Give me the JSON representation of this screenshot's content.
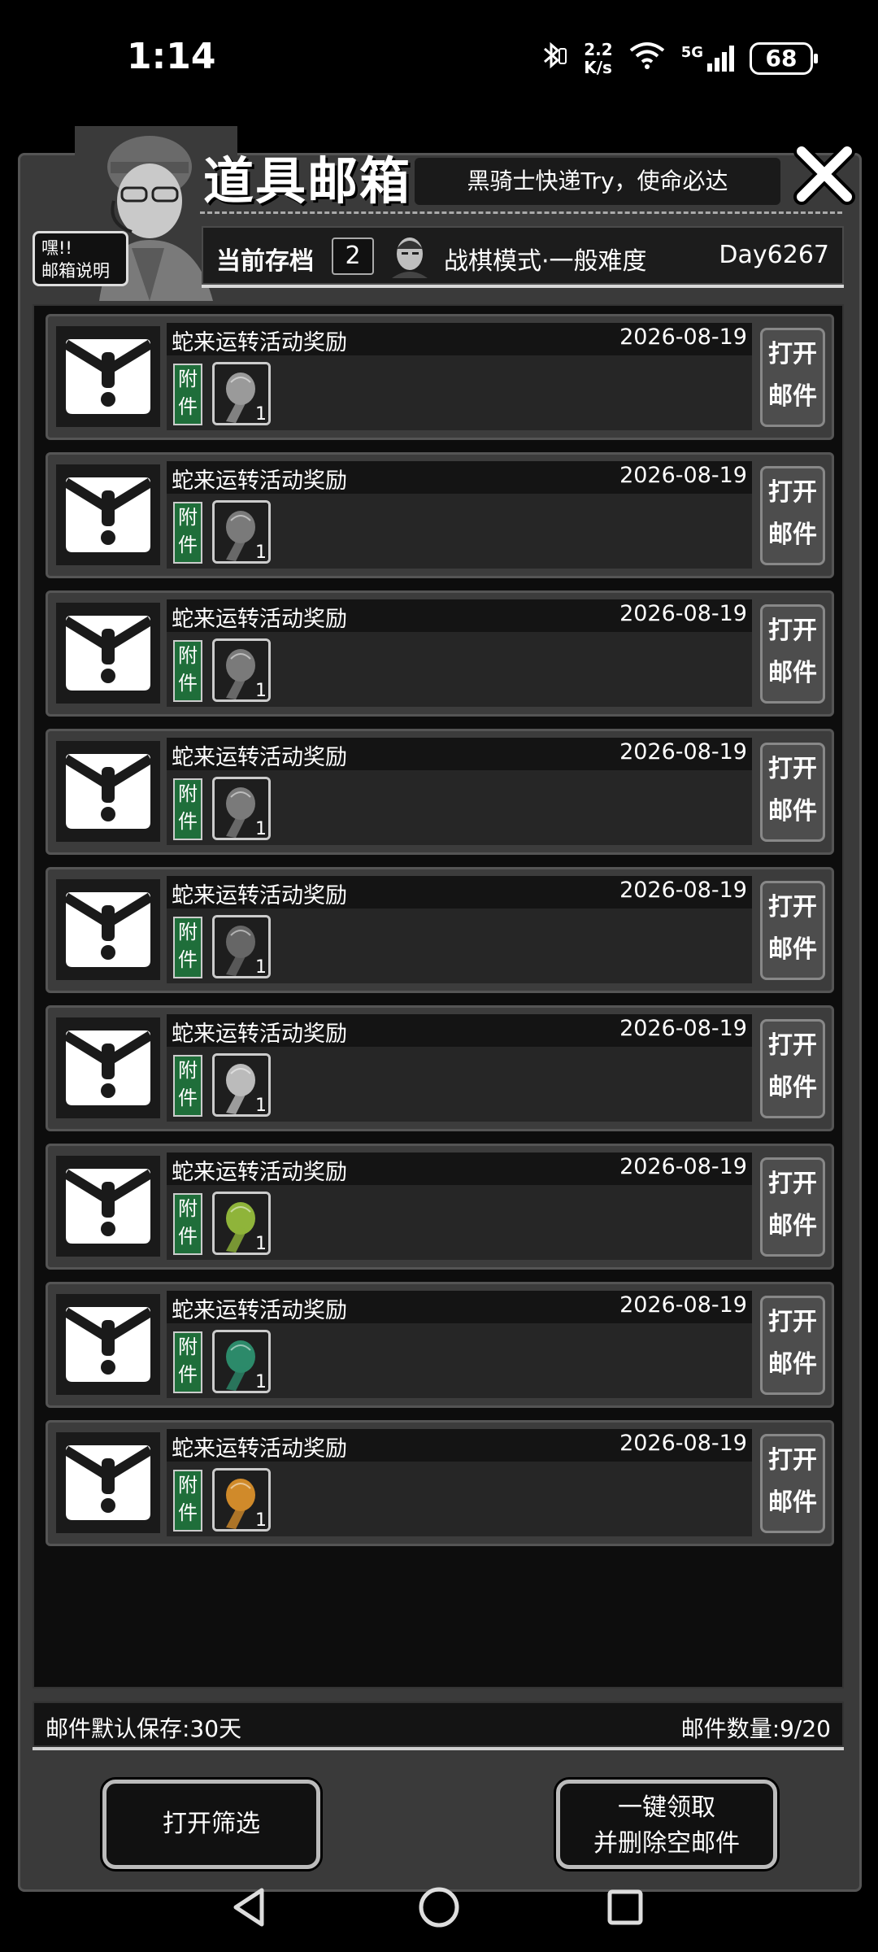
{
  "status": {
    "time": "1:14",
    "net_speed_value": "2.2",
    "net_speed_unit": "K/s",
    "signal": "5G",
    "battery": "68"
  },
  "header": {
    "title": "道具邮箱",
    "subtitle": "黑骑士快递Try，使命必达",
    "help_label": "嘿!!\n邮箱说明"
  },
  "save": {
    "label": "当前存档",
    "slot": "2",
    "mode": "战棋模式·一般难度",
    "day": "Day6267"
  },
  "mails": [
    {
      "title": "蛇来运转活动奖励",
      "date": "2026-08-19",
      "attach_label": "附件",
      "qty": "1",
      "item_color": "#9a9a9a",
      "open_label": "打开邮件"
    },
    {
      "title": "蛇来运转活动奖励",
      "date": "2026-08-19",
      "attach_label": "附件",
      "qty": "1",
      "item_color": "#7a7a7a",
      "open_label": "打开邮件"
    },
    {
      "title": "蛇来运转活动奖励",
      "date": "2026-08-19",
      "attach_label": "附件",
      "qty": "1",
      "item_color": "#7a7a7a",
      "open_label": "打开邮件"
    },
    {
      "title": "蛇来运转活动奖励",
      "date": "2026-08-19",
      "attach_label": "附件",
      "qty": "1",
      "item_color": "#7a7a7a",
      "open_label": "打开邮件"
    },
    {
      "title": "蛇来运转活动奖励",
      "date": "2026-08-19",
      "attach_label": "附件",
      "qty": "1",
      "item_color": "#666666",
      "open_label": "打开邮件"
    },
    {
      "title": "蛇来运转活动奖励",
      "date": "2026-08-19",
      "attach_label": "附件",
      "qty": "1",
      "item_color": "#bbbbbb",
      "open_label": "打开邮件"
    },
    {
      "title": "蛇来运转活动奖励",
      "date": "2026-08-19",
      "attach_label": "附件",
      "qty": "1",
      "item_color": "#8fb43a",
      "open_label": "打开邮件"
    },
    {
      "title": "蛇来运转活动奖励",
      "date": "2026-08-19",
      "attach_label": "附件",
      "qty": "1",
      "item_color": "#2c8a6a",
      "open_label": "打开邮件"
    },
    {
      "title": "蛇来运转活动奖励",
      "date": "2026-08-19",
      "attach_label": "附件",
      "qty": "1",
      "item_color": "#d08a2a",
      "open_label": "打开邮件"
    }
  ],
  "footer": {
    "keep_days": "邮件默认保存:30天",
    "mail_count": "邮件数量:9/20"
  },
  "actions": {
    "filter_label": "打开筛选",
    "claim_label_line1": "一键领取",
    "claim_label_line2": "并删除空邮件"
  }
}
